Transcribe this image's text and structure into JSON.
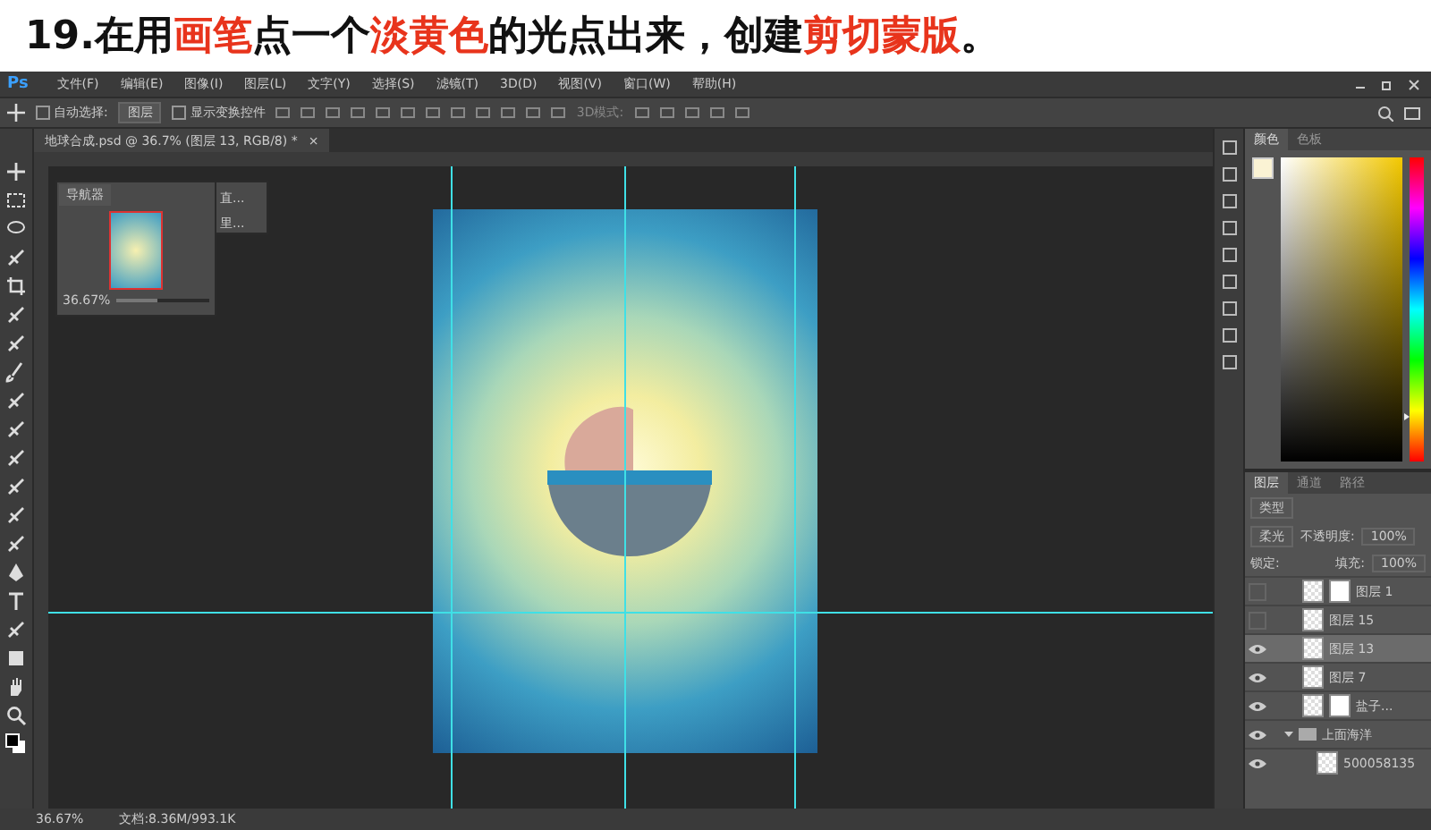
{
  "title": {
    "segments": [
      {
        "text": "19.在用",
        "highlight": false
      },
      {
        "text": "画笔",
        "highlight": true
      },
      {
        "text": "点一个",
        "highlight": false
      },
      {
        "text": "淡黄色",
        "highlight": true
      },
      {
        "text": "的光点出来，创建",
        "highlight": false
      },
      {
        "text": "剪切蒙版",
        "highlight": true
      },
      {
        "text": "。",
        "highlight": false
      }
    ]
  },
  "app_logo": "Ps",
  "menu": [
    "文件(F)",
    "编辑(E)",
    "图像(I)",
    "图层(L)",
    "文字(Y)",
    "选择(S)",
    "滤镜(T)",
    "3D(D)",
    "视图(V)",
    "窗口(W)",
    "帮助(H)"
  ],
  "options_bar": {
    "auto_select": {
      "label": "自动选择:",
      "checked": false
    },
    "auto_select_target": "图层",
    "show_transform": {
      "label": "显示变换控件",
      "checked": false
    },
    "mode_3d": "3D模式:"
  },
  "document_tab": {
    "title": "地球合成.psd @ 36.7% (图层 13, RGB/8) *",
    "close": "×"
  },
  "navigator": {
    "title": "导航器",
    "zoom": "36.67%",
    "level": 0.45
  },
  "mini_panel": {
    "items": [
      "直...",
      "里..."
    ]
  },
  "color_panel": {
    "hue": {
      "level": 0.15
    },
    "tabs": [
      {
        "label": "颜色",
        "selected": true
      },
      {
        "label": "色板",
        "selected": false
      }
    ]
  },
  "layers_panel": {
    "tabs": [
      {
        "label": "图层",
        "selected": true
      },
      {
        "label": "通道",
        "selected": false
      },
      {
        "label": "路径",
        "selected": false
      }
    ],
    "filter": "类型",
    "blend_mode": "柔光",
    "opacity_label": "不透明度:",
    "opacity": "100%",
    "lock_label": "锁定:",
    "fill_label": "填充:",
    "fill": "100%",
    "layers": [
      {
        "name": "图层 1",
        "kind": "masked",
        "visible": false,
        "selected": false
      },
      {
        "name": "图层 15",
        "kind": "plain",
        "visible": false,
        "selected": false
      },
      {
        "name": "图层 13",
        "kind": "plain",
        "visible": true,
        "selected": true
      },
      {
        "name": "图层 7",
        "kind": "plain",
        "visible": true,
        "selected": false
      },
      {
        "name": "盐子...",
        "kind": "masked",
        "visible": true,
        "selected": false
      },
      {
        "name": "上面海洋",
        "kind": "group",
        "visible": true,
        "selected": false,
        "expanded": true,
        "children": [
          {
            "name": "500058135",
            "kind": "plain",
            "visible": true,
            "selected": false
          }
        ]
      }
    ]
  },
  "status_bar": {
    "zoom": "36.67%",
    "doc_size": "文档:8.36M/993.1K"
  }
}
